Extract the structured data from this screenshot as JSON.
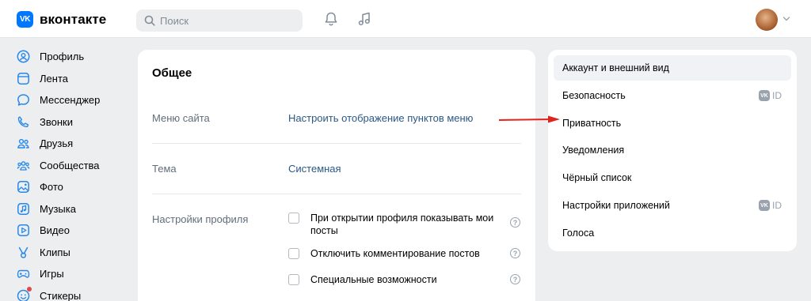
{
  "header": {
    "logo_badge": "VK",
    "logo_text": "вконтакте",
    "search_placeholder": "Поиск"
  },
  "left_nav": [
    {
      "label": "Профиль",
      "icon": "profile-icon"
    },
    {
      "label": "Лента",
      "icon": "feed-icon"
    },
    {
      "label": "Мессенджер",
      "icon": "messenger-icon"
    },
    {
      "label": "Звонки",
      "icon": "calls-icon"
    },
    {
      "label": "Друзья",
      "icon": "friends-icon"
    },
    {
      "label": "Сообщества",
      "icon": "communities-icon"
    },
    {
      "label": "Фото",
      "icon": "photo-icon"
    },
    {
      "label": "Музыка",
      "icon": "music-icon"
    },
    {
      "label": "Видео",
      "icon": "video-icon"
    },
    {
      "label": "Клипы",
      "icon": "clips-icon"
    },
    {
      "label": "Игры",
      "icon": "games-icon"
    },
    {
      "label": "Стикеры",
      "icon": "stickers-icon"
    }
  ],
  "main": {
    "title": "Общее",
    "rows": {
      "menu": {
        "label": "Меню сайта",
        "link": "Настроить отображение пунктов меню"
      },
      "theme": {
        "label": "Тема",
        "link": "Системная"
      },
      "profile": {
        "label": "Настройки профиля"
      }
    },
    "options": [
      {
        "text": "При открытии профиля показывать мои посты",
        "checked": false
      },
      {
        "text": "Отключить комментирование постов",
        "checked": false
      },
      {
        "text": "Специальные возможности",
        "checked": false
      }
    ],
    "help_glyph": "?"
  },
  "settings_menu": [
    {
      "label": "Аккаунт и внешний вид",
      "active": true,
      "badge": ""
    },
    {
      "label": "Безопасность",
      "active": false,
      "badge": "ID"
    },
    {
      "label": "Приватность",
      "active": false,
      "badge": ""
    },
    {
      "label": "Уведомления",
      "active": false,
      "badge": ""
    },
    {
      "label": "Чёрный список",
      "active": false,
      "badge": ""
    },
    {
      "label": "Настройки приложений",
      "active": false,
      "badge": "ID"
    },
    {
      "label": "Голоса",
      "active": false,
      "badge": ""
    }
  ],
  "vkid_badge_glyph": "VK",
  "colors": {
    "accent": "#0077ff",
    "link": "#2a5885",
    "annotation_arrow": "#e0231b"
  }
}
